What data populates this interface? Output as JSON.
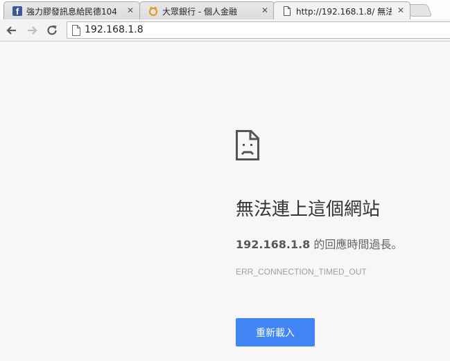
{
  "tabs": [
    {
      "title": "強力膠發訊息給民德104",
      "close": "✕",
      "favicon": "facebook-icon",
      "active": false
    },
    {
      "title": "大眾銀行 - 個人金融",
      "close": "✕",
      "favicon": "bank-logo-icon",
      "active": false
    },
    {
      "title": "http://192.168.1.8/ 無法連",
      "close": "✕",
      "favicon": "page-icon",
      "active": true
    }
  ],
  "favicons": {
    "facebook_letter": "f"
  },
  "toolbar": {
    "back_icon": "back-arrow-icon",
    "forward_icon": "forward-arrow-icon",
    "reload_icon": "reload-icon",
    "url": "192.168.1.8"
  },
  "error": {
    "title": "無法連上這個網站",
    "host": "192.168.1.8",
    "message_suffix": " 的回應時間過長。",
    "code": "ERR_CONNECTION_TIMED_OUT",
    "reload_label": "重新載入"
  },
  "colors": {
    "accent_button": "#4285f4",
    "facebook_blue": "#3b5998",
    "page_background": "#f7f7f7"
  }
}
